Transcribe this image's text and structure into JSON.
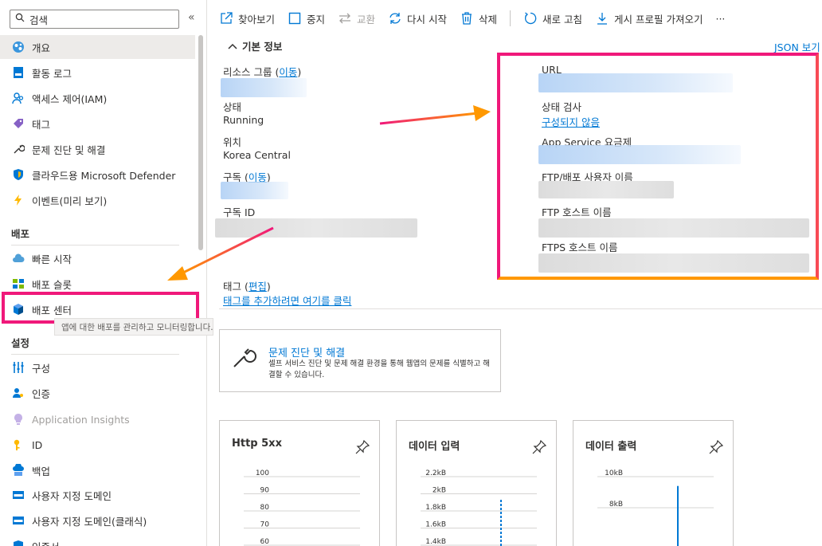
{
  "sidebar": {
    "search_placeholder": "검색",
    "collapse_glyph": "«",
    "top_items": [
      {
        "label": "개요",
        "icon": "globe-icon",
        "active": true
      },
      {
        "label": "활동 로그",
        "icon": "activity-log-icon"
      },
      {
        "label": "액세스 제어(IAM)",
        "icon": "people-icon"
      },
      {
        "label": "태그",
        "icon": "tag-icon"
      },
      {
        "label": "문제 진단 및 해결",
        "icon": "wrench-icon"
      },
      {
        "label": "클라우드용 Microsoft Defender",
        "icon": "shield-icon"
      },
      {
        "label": "이벤트(미리 보기)",
        "icon": "lightning-icon"
      }
    ],
    "section_deploy": "배포",
    "deploy_items": [
      {
        "label": "빠른 시작",
        "icon": "cloud-icon"
      },
      {
        "label": "배포 슬롯",
        "icon": "slots-icon"
      },
      {
        "label": "배포 센터",
        "icon": "cube-icon"
      }
    ],
    "tooltip": "앱에 대한 배포를 관리하고 모니터링합니다.",
    "section_settings": "설정",
    "settings_items": [
      {
        "label": "구성",
        "icon": "sliders-icon"
      },
      {
        "label": "인증",
        "icon": "user-key-icon"
      },
      {
        "label": "Application Insights",
        "icon": "bulb-icon",
        "disabled": true
      },
      {
        "label": "ID",
        "icon": "key-icon"
      },
      {
        "label": "백업",
        "icon": "backup-icon"
      },
      {
        "label": "사용자 지정 도메인",
        "icon": "www-icon"
      },
      {
        "label": "사용자 지정 도메인(클래식)",
        "icon": "www-icon"
      },
      {
        "label": "인증서",
        "icon": "certificate-icon"
      }
    ]
  },
  "toolbar": {
    "browse": "찾아보기",
    "stop": "중지",
    "swap": "교환",
    "restart": "다시 시작",
    "delete": "삭제",
    "refresh": "새로 고침",
    "get_profile": "게시 프로필 가져오기",
    "more": "···"
  },
  "essentials": {
    "title": "기본 정보",
    "json_view": "JSON 보기",
    "resource_group_label": "리소스 그룹 (",
    "move_link": "이동",
    "close_paren": ")",
    "status_label": "상태",
    "status_value": "Running",
    "location_label": "위치",
    "location_value": "Korea Central",
    "subscription_label": "구독 (",
    "subscription_id_label": "구독 ID",
    "url_label": "URL",
    "health_label": "상태 검사",
    "health_value": "구성되지 않음",
    "plan_label": "App Service 요금제",
    "ftp_user_label": "FTP/배포 사용자 이름",
    "ftp_host_label": "FTP 호스트 이름",
    "ftps_host_label": "FTPS 호스트 이름",
    "tags_label": "태그 (",
    "edit_link": "편집",
    "add_tags_link": "태그를 추가하려면 여기를 클릭"
  },
  "diagnose_card": {
    "title": "문제 진단 및 해결",
    "description": "셀프 서비스 진단 및 문제 해결 환경을 통해 웹앱의 문제를 식별하고 해결할 수 있습니다."
  },
  "chart_data": [
    {
      "type": "line",
      "title": "Http 5xx",
      "y_ticks": [
        "100",
        "90",
        "80",
        "70",
        "60"
      ],
      "series": []
    },
    {
      "type": "line",
      "title": "데이터 입력",
      "y_ticks": [
        "2.2kB",
        "2kB",
        "1.8kB",
        "1.6kB",
        "1.4kB"
      ],
      "series": []
    },
    {
      "type": "line",
      "title": "데이터 출력",
      "y_ticks": [
        "10kB",
        "8kB"
      ],
      "series": []
    }
  ],
  "colors": {
    "accent": "#0078d4",
    "highlight_pink": "#f0187a",
    "highlight_orange": "#ff9800"
  }
}
